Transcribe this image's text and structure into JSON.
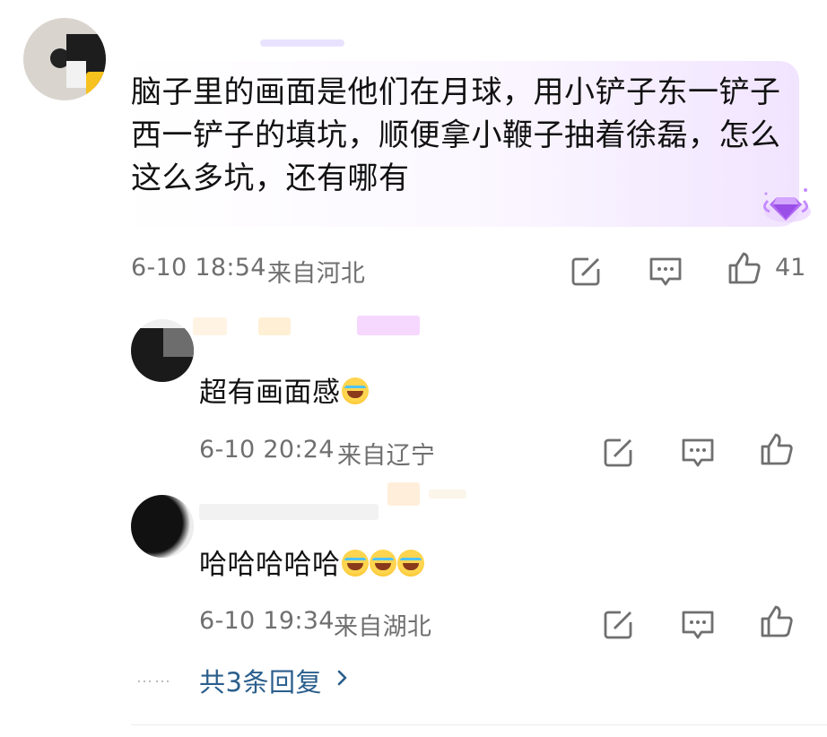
{
  "main_comment": {
    "text": "脑子里的画面是他们在月球，用小铲子东一铲子西一铲子的填坑，顺便拿小鞭子抽着徐磊，怎么这么多坑，还有哪有",
    "date_time": "6-10 18:54",
    "location": "来自河北",
    "like_count": "41"
  },
  "replies": [
    {
      "text": "超有画面感",
      "emoji_count": 1,
      "date_time": "6-10 20:24",
      "location": "来自辽宁"
    },
    {
      "text": "哈哈哈哈哈",
      "emoji_count": 3,
      "date_time": "6-10 19:34",
      "location": "来自湖北"
    }
  ],
  "more_replies": {
    "dots": "……",
    "label": "共3条回复",
    "chevron": "›"
  },
  "icons": {
    "share": "share-icon",
    "comment": "comment-icon",
    "like": "thumbs-up-icon",
    "badge": "gem-badge-icon"
  },
  "colors": {
    "meta_text": "#6f6f6f",
    "link_blue": "#2a5e8c",
    "bubble_purple": "#f1e4ff",
    "badge_purple": "#b16cf3"
  }
}
